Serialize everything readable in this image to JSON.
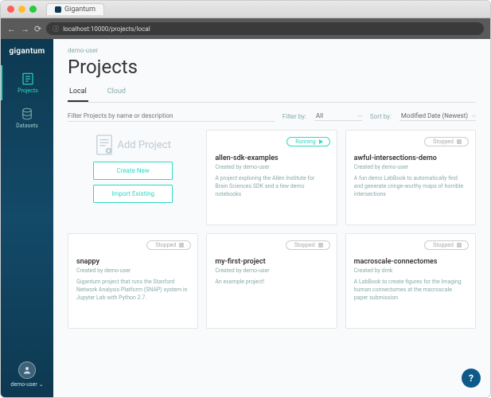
{
  "browser": {
    "tab_title": "Gigantum",
    "url": "localhost:10000/projects/local"
  },
  "sidebar": {
    "logo": "gigantum",
    "items": [
      {
        "label": "Projects",
        "icon": "projects",
        "active": true
      },
      {
        "label": "Datasets",
        "icon": "datasets",
        "active": false
      }
    ],
    "user": "demo-user"
  },
  "page": {
    "breadcrumb": "demo-user",
    "title": "Projects",
    "tabs": [
      {
        "label": "Local",
        "active": true
      },
      {
        "label": "Cloud",
        "active": false
      }
    ],
    "search_placeholder": "Filter Projects by name or description",
    "filter_label": "Filter by:",
    "filter_value": "All",
    "sort_label": "Sort by:",
    "sort_value": "Modified Date (Newest)"
  },
  "add_project": {
    "title": "Add Project",
    "create": "Create New",
    "import": "Import Existing"
  },
  "status_labels": {
    "running": "Running",
    "stopped": "Stopped"
  },
  "projects": [
    {
      "name": "allen-sdk-examples",
      "author": "Created by demo-user",
      "desc": "A project exploring the Allen Institute for Brain Sciences SDK and a few demo notebooks",
      "status": "running"
    },
    {
      "name": "awful-intersections-demo",
      "author": "Created by demo-user",
      "desc": "A fun demo LabBook to automatically find and generate cringe-worthy maps of horrible intersections",
      "status": "stopped"
    },
    {
      "name": "snappy",
      "author": "Created by demo-user",
      "desc": "Gigantum project that runs the Stanford Network Analysis Platform (SNAP) system in Jupyter Lab with Python 2.7.",
      "status": "stopped"
    },
    {
      "name": "my-first-project",
      "author": "Created by demo-user",
      "desc": "An example project!",
      "status": "stopped"
    },
    {
      "name": "macroscale-connectomes",
      "author": "Created by dmk",
      "desc": "A LabBook to create figures for the Imaging human connectomes at the macroscale paper submission",
      "status": "stopped"
    }
  ],
  "help": "?"
}
